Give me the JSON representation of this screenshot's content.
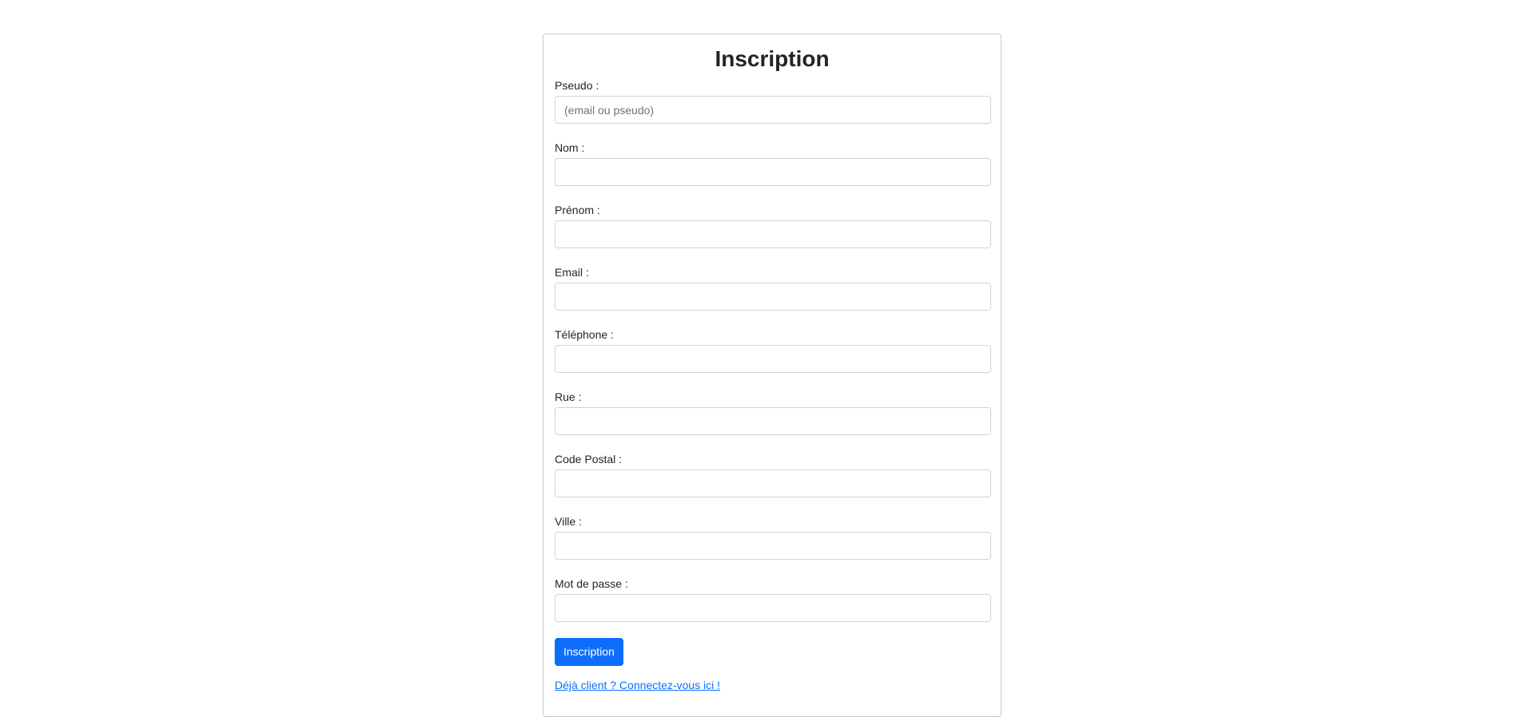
{
  "form": {
    "title": "Inscription",
    "fields": [
      {
        "label": "Pseudo :",
        "value": "",
        "placeholder": "(email ou pseudo)"
      },
      {
        "label": "Nom :",
        "value": "",
        "placeholder": ""
      },
      {
        "label": "Prénom :",
        "value": "",
        "placeholder": ""
      },
      {
        "label": "Email :",
        "value": "",
        "placeholder": ""
      },
      {
        "label": "Téléphone :",
        "value": "",
        "placeholder": ""
      },
      {
        "label": "Rue :",
        "value": "",
        "placeholder": ""
      },
      {
        "label": "Code Postal :",
        "value": "",
        "placeholder": ""
      },
      {
        "label": "Ville :",
        "value": "",
        "placeholder": ""
      },
      {
        "label": "Mot de passe :",
        "value": "",
        "placeholder": ""
      }
    ],
    "submit_label": "Inscription",
    "login_link": "Déjà client ? Connectez-vous ici !"
  },
  "colors": {
    "primary": "#0d6efd",
    "border": "#ced4da",
    "text": "#212529"
  }
}
